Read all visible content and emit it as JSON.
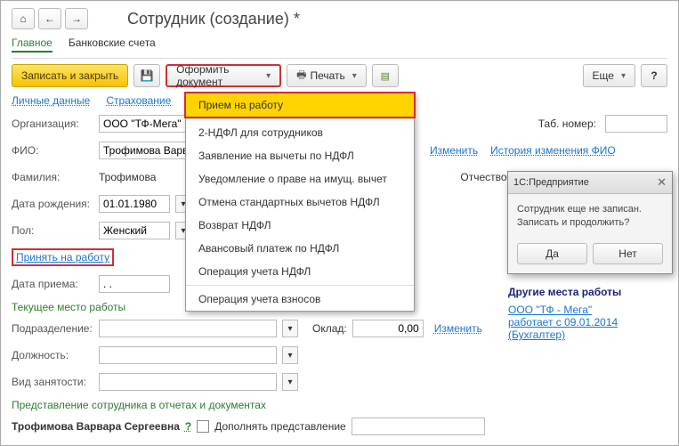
{
  "title": "Сотрудник (создание) *",
  "tabs": {
    "main": "Главное",
    "bank": "Банковские счета"
  },
  "toolbar": {
    "save_close": "Записать и закрыть",
    "doc": "Оформить документ",
    "print": "Печать",
    "more": "Еще",
    "help": "?"
  },
  "subtabs": {
    "personal": "Личные данные",
    "insurance": "Страхование"
  },
  "labels": {
    "org": "Организация:",
    "fio": "ФИО:",
    "surname": "Фамилия:",
    "birth": "Дата рождения:",
    "sex": "Пол:",
    "hire": "Принять на работу",
    "hire_date": "Дата приема:",
    "current_place": "Текущее место работы",
    "dept": "Подразделение:",
    "position": "Должность:",
    "employment": "Вид занятости:",
    "salary": "Оклад:",
    "change": "Изменить",
    "history": "История изменения ФИО",
    "tabn": "Таб. номер:",
    "patr": "Отчество",
    "repr_header": "Представление сотрудника в отчетах и документах",
    "repr_name": "Трофимова Варвара Сергеевна",
    "repr_add": "Дополнять представление"
  },
  "values": {
    "org": "ООО \"ТФ-Мега\"",
    "fio": "Трофимова Варвара С",
    "surname": "Трофимова",
    "birth": "01.01.1980",
    "sex": "Женский",
    "hire_date": ". .",
    "salary": "0,00"
  },
  "menu": {
    "items": [
      "Прием на работу",
      "2-НДФЛ для сотрудников",
      "Заявление на вычеты по НДФЛ",
      "Уведомление о праве на имущ. вычет",
      "Отмена стандартных вычетов НДФЛ",
      "Возврат НДФЛ",
      "Авансовый платеж по НДФЛ",
      "Операция учета НДФЛ",
      "Операция учета взносов"
    ]
  },
  "dialog": {
    "title": "1С:Предприятие",
    "line1": "Сотрудник еще не записан.",
    "line2": "Записать и продолжить?",
    "yes": "Да",
    "no": "Нет"
  },
  "other_places": {
    "header": "Другие места работы",
    "org": "ООО \"ТФ - Мега\"",
    "since": "работает с 09.01.2014",
    "role": "(Бухгалтер)"
  }
}
